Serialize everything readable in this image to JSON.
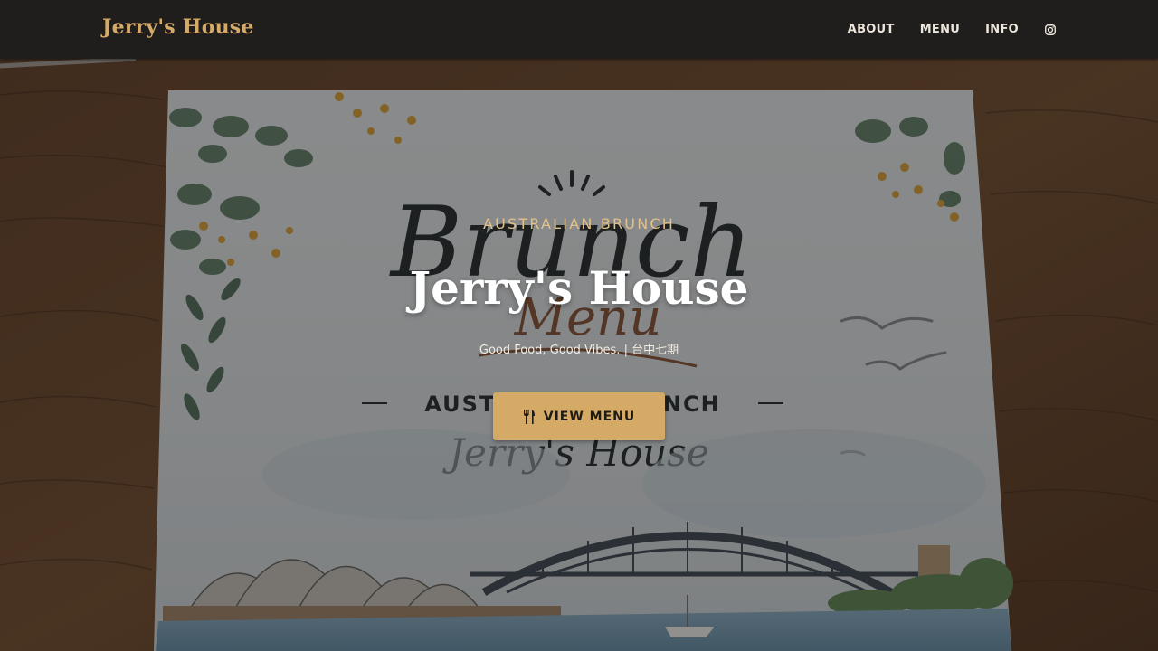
{
  "nav": {
    "brand": "Jerry's House",
    "links": [
      "ABOUT",
      "MENU",
      "INFO"
    ],
    "social_icon": "instagram-icon"
  },
  "hero": {
    "kicker": "AUSTRALIAN BRUNCH",
    "title": "Jerry's House",
    "subtitle": "Good Food, Good Vibes. | 台中七期",
    "button_label": "VIEW MENU",
    "button_icon": "utensils-icon",
    "background_image": "Printed brunch menu on a wooden table with eucalyptus leaves, wattle flowers, seagulls, Sydney Opera House and Harbour Bridge illustration",
    "menu_art": {
      "script_line1": "Brunch",
      "script_line2": "Menu",
      "banner": "AUSTRALIAN BRUNCH",
      "signature": "Jerry's House"
    }
  },
  "colors": {
    "navbar_bg": "#1f1e1d",
    "brand_gold": "#d5aa69",
    "nav_text": "#ece6dc",
    "kicker": "#e2c18a",
    "button_bg": "#d4aa66",
    "button_text": "#1e1a15",
    "overlay": "rgba(0,0,0,0.40)"
  }
}
